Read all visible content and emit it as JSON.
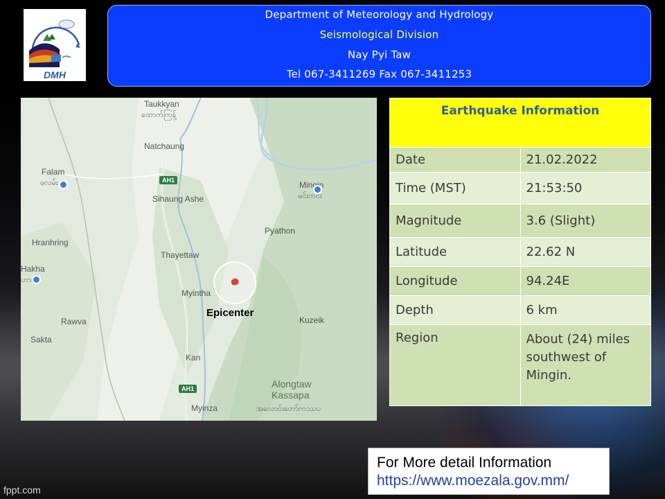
{
  "header": {
    "line1": "Department of Meteorology and Hydrology",
    "line2": "Seismological Division",
    "line3": "Nay Pyi Taw",
    "line4": "Tel 067-3411269 Fax 067-3411253"
  },
  "logo": {
    "text": "DMH"
  },
  "map": {
    "epicenter_label": "Epicenter",
    "places": [
      {
        "name": "Taukkyan",
        "mm": "ထောက်ကြန့်"
      },
      {
        "name": "Natchaung"
      },
      {
        "name": "Falam",
        "mm": "ဖလမ်း"
      },
      {
        "name": "Mingin",
        "mm": "မင်းကင်း"
      },
      {
        "name": "Sihaung Ashe"
      },
      {
        "name": "Pyathon"
      },
      {
        "name": "Hranhring"
      },
      {
        "name": "Thayettaw"
      },
      {
        "name": "Hakha",
        "mm": "ဟားခါး"
      },
      {
        "name": "Myintha"
      },
      {
        "name": "Kuzeik"
      },
      {
        "name": "Rawva"
      },
      {
        "name": "Sakta"
      },
      {
        "name": "Kan"
      },
      {
        "name": "Myinza"
      },
      {
        "name": "Alongtaw Kassapa",
        "mm": "အလောင်းတော်ကဿပ"
      }
    ],
    "highway": "AH1"
  },
  "info": {
    "title": "Earthquake Information",
    "rows": [
      {
        "label": "Date",
        "value": "21.02.2022"
      },
      {
        "label": "Time (MST)",
        "value": "21:53:50"
      },
      {
        "label": "Magnitude",
        "value": "3.6 (Slight)"
      },
      {
        "label": "Latitude",
        "value": "22.62 N"
      },
      {
        "label": "Longitude",
        "value": "94.24E"
      },
      {
        "label": "Depth",
        "value": "6 km"
      },
      {
        "label": "Region",
        "value": "About (24) miles southwest of  Mingin."
      }
    ]
  },
  "more": {
    "line1": "For More detail Information",
    "url": "https://www.moezala.gov.mm/"
  },
  "watermark": "fppt.com"
}
